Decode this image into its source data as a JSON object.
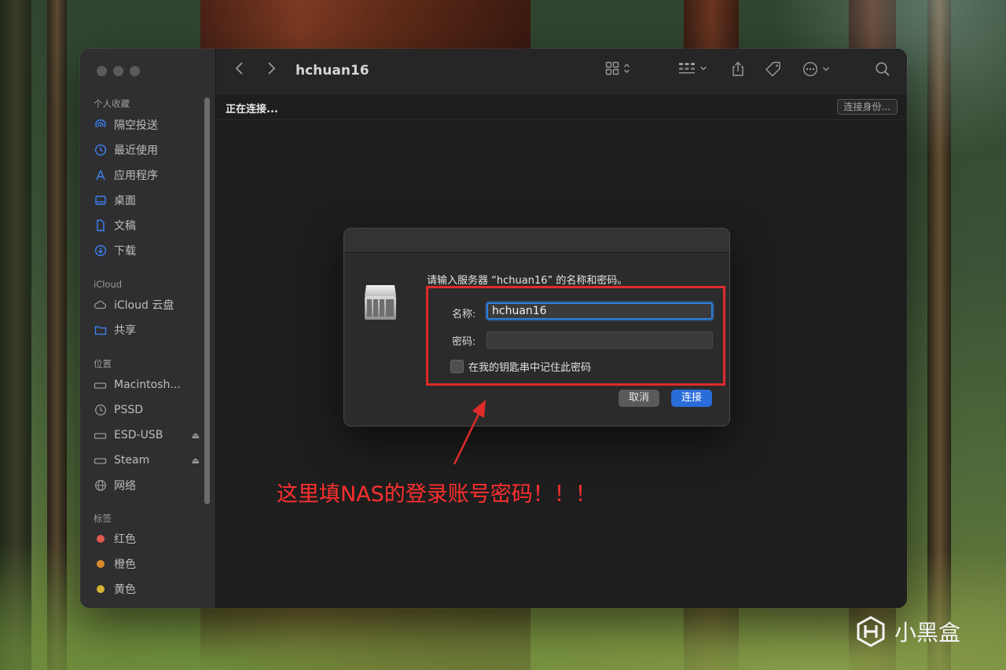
{
  "window": {
    "title": "hchuan16",
    "status": "正在连接...",
    "connect_as": "连接身份..."
  },
  "sidebar": {
    "favorites_header": "个人收藏",
    "favorites": [
      {
        "label": "隔空投送",
        "icon": "airdrop-icon"
      },
      {
        "label": "最近使用",
        "icon": "clock-icon"
      },
      {
        "label": "应用程序",
        "icon": "applications-icon"
      },
      {
        "label": "桌面",
        "icon": "desktop-icon"
      },
      {
        "label": "文稿",
        "icon": "document-icon"
      },
      {
        "label": "下载",
        "icon": "download-icon"
      }
    ],
    "icloud_header": "iCloud",
    "icloud": [
      {
        "label": "iCloud 云盘",
        "icon": "cloud-icon"
      },
      {
        "label": "共享",
        "icon": "shared-folder-icon"
      }
    ],
    "locations_header": "位置",
    "locations": [
      {
        "label": "Macintosh...",
        "icon": "disk-icon"
      },
      {
        "label": "PSSD",
        "icon": "time-machine-icon"
      },
      {
        "label": "ESD-USB",
        "icon": "disk-icon",
        "eject": true
      },
      {
        "label": "Steam",
        "icon": "disk-icon",
        "eject": true
      },
      {
        "label": "网络",
        "icon": "network-icon"
      }
    ],
    "tags_header": "标签",
    "tags": [
      {
        "label": "红色",
        "color": "#e05a4f"
      },
      {
        "label": "橙色",
        "color": "#d98a2b"
      },
      {
        "label": "黄色",
        "color": "#d6b532"
      }
    ]
  },
  "dialog": {
    "prompt": "请输入服务器 “hchuan16” 的名称和密码。",
    "name_label": "名称:",
    "name_value": "hchuan16",
    "password_label": "密码:",
    "password_value": "",
    "remember_label": "在我的钥匙串中记住此密码",
    "cancel_label": "取消",
    "connect_label": "连接"
  },
  "annotation": {
    "text": "这里填NAS的登录账号密码！！！",
    "color": "#ff2f2f"
  },
  "watermark": {
    "text": "小黑盒"
  }
}
